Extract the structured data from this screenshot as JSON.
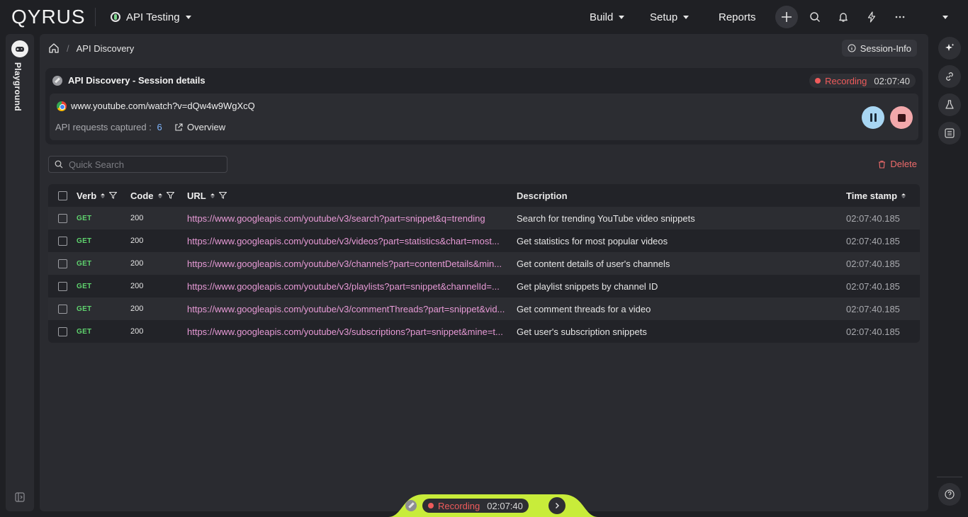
{
  "app": {
    "logo": "QYRUS",
    "project": "API Testing"
  },
  "nav": {
    "build": "Build",
    "setup": "Setup",
    "reports": "Reports"
  },
  "left_rail": {
    "label": "Playground"
  },
  "breadcrumb": {
    "current": "API Discovery"
  },
  "session_info_label": "Session-Info",
  "session": {
    "title": "API Discovery - Session details",
    "recording_label": "Recording",
    "timer": "02:07:40",
    "url": "www.youtube.com/watch?v=dQw4w9WgXcQ",
    "captured_label": "API requests captured :",
    "captured_count": "6",
    "overview_label": "Overview"
  },
  "search": {
    "placeholder": "Quick Search",
    "value": ""
  },
  "delete_label": "Delete",
  "table": {
    "headers": {
      "verb": "Verb",
      "code": "Code",
      "url": "URL",
      "description": "Description",
      "timestamp": "Time stamp"
    },
    "rows": [
      {
        "verb": "GET",
        "code": "200",
        "url": "https://www.googleapis.com/youtube/v3/search?part=snippet&q=trending",
        "description": "Search for trending YouTube video snippets",
        "time": "02:07:40.185"
      },
      {
        "verb": "GET",
        "code": "200",
        "url": "https://www.googleapis.com/youtube/v3/videos?part=statistics&chart=most...",
        "description": "Get statistics for most popular videos",
        "time": "02:07:40.185"
      },
      {
        "verb": "GET",
        "code": "200",
        "url": "https://www.googleapis.com/youtube/v3/channels?part=contentDetails&min...",
        "description": "Get content details of user's channels",
        "time": "02:07:40.185"
      },
      {
        "verb": "GET",
        "code": "200",
        "url": "https://www.googleapis.com/youtube/v3/playlists?part=snippet&channelId=...",
        "description": "Get playlist snippets by channel ID",
        "time": "02:07:40.185"
      },
      {
        "verb": "GET",
        "code": "200",
        "url": "https://www.googleapis.com/youtube/v3/commentThreads?part=snippet&vid...",
        "description": "Get comment threads for a video",
        "time": "02:07:40.185"
      },
      {
        "verb": "GET",
        "code": "200",
        "url": "https://www.googleapis.com/youtube/v3/subscriptions?part=snippet&mine=t...",
        "description": "Get user's subscription snippets",
        "time": "02:07:40.185"
      }
    ]
  },
  "bottom_bar": {
    "recording_label": "Recording",
    "timer": "02:07:40"
  },
  "colors": {
    "accent_green": "#c8ec3a",
    "recording_red": "#ef5b5b",
    "link_pink": "#e79ad6",
    "verb_green": "#5fd36e",
    "count_blue": "#7fb6ff"
  }
}
